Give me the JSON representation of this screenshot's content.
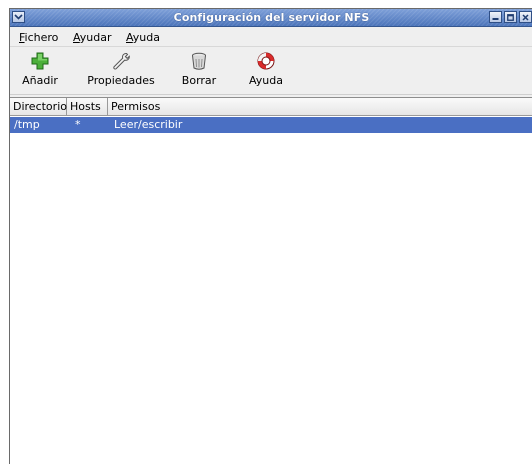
{
  "window": {
    "title": "Configuración del servidor NFS"
  },
  "menubar": {
    "items": [
      {
        "mnemonic": "F",
        "rest": "ichero"
      },
      {
        "mnemonic": "A",
        "rest": "yudar"
      },
      {
        "mnemonic": "A",
        "rest": "yuda"
      }
    ]
  },
  "toolbar": {
    "add_label": "Añadir",
    "properties_label": "Propiedades",
    "delete_label": "Borrar",
    "help_label": "Ayuda"
  },
  "table": {
    "columns": [
      "Directorio",
      "Hosts",
      "Permisos"
    ],
    "rows": [
      {
        "directory": "/tmp",
        "hosts": "*",
        "permissions": "Leer/escribir",
        "selected": true
      }
    ]
  },
  "colors": {
    "selection": "#4a6fc3",
    "titlebar": "#5b84c8"
  },
  "icons": {
    "add": "green-plus-icon",
    "properties": "wrench-icon",
    "delete": "trash-can-icon",
    "help": "life-ring-icon"
  }
}
